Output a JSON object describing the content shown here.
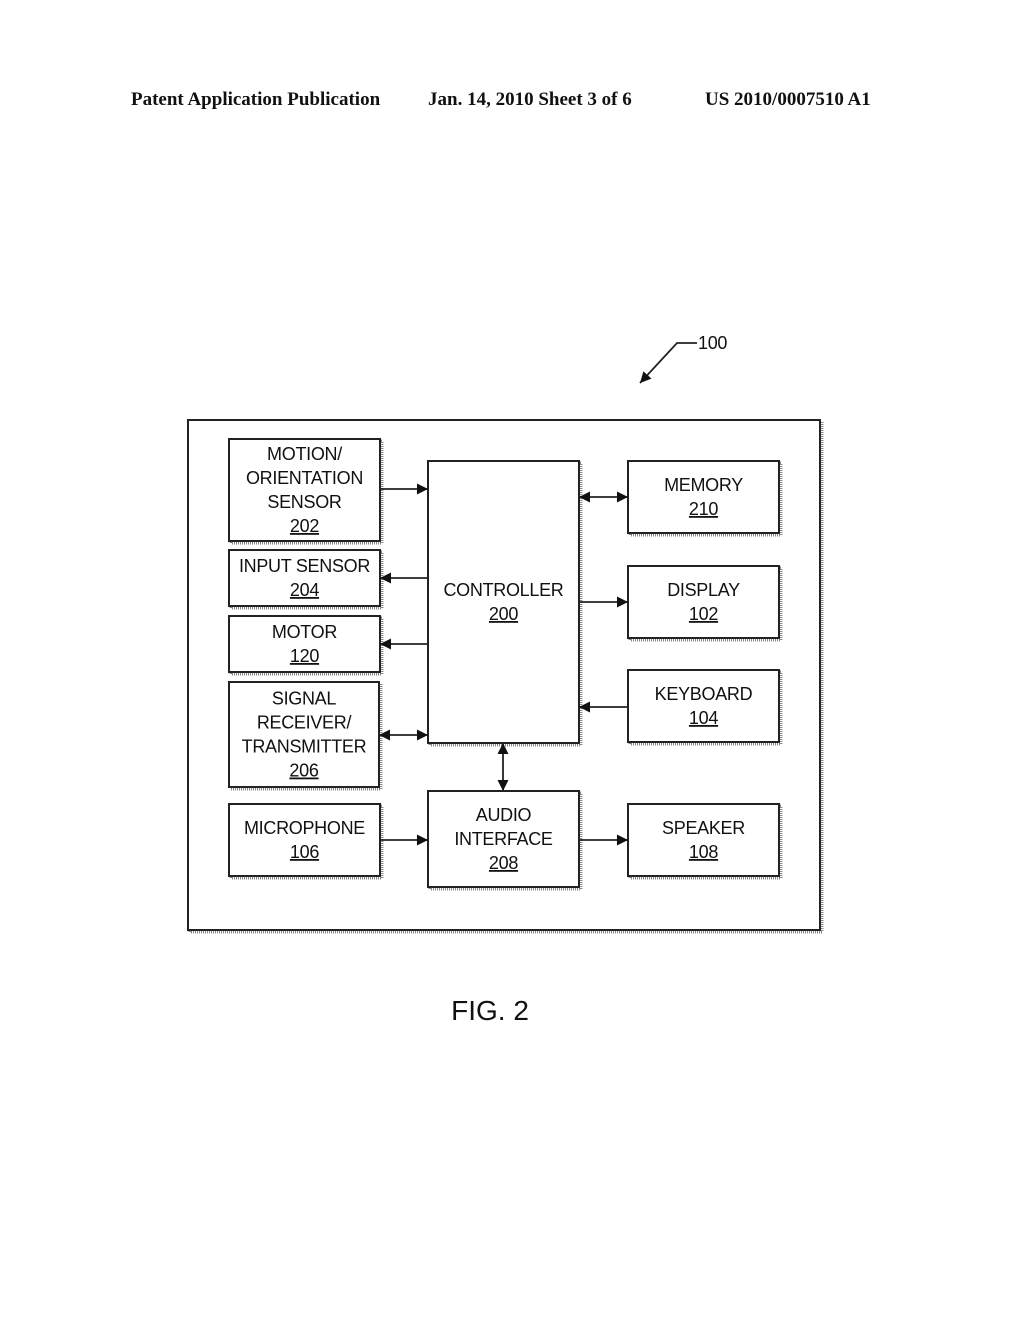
{
  "header": {
    "left": "Patent Application Publication",
    "middle": "Jan. 14, 2010  Sheet 3 of 6",
    "right": "US 2010/0007510 A1"
  },
  "diagram": {
    "reference": "100",
    "figure_label": "FIG. 2",
    "blocks": {
      "motion_sensor": {
        "lines": [
          "MOTION/",
          "ORIENTATION",
          "SENSOR"
        ],
        "number": "202"
      },
      "input_sensor": {
        "lines": [
          "INPUT SENSOR"
        ],
        "number": "204"
      },
      "motor": {
        "lines": [
          "MOTOR"
        ],
        "number": "120"
      },
      "signal": {
        "lines": [
          "SIGNAL",
          "RECEIVER/",
          "TRANSMITTER"
        ],
        "number": "206"
      },
      "microphone": {
        "lines": [
          "MICROPHONE"
        ],
        "number": "106"
      },
      "controller": {
        "lines": [
          "CONTROLLER"
        ],
        "number": "200"
      },
      "audio": {
        "lines": [
          "AUDIO",
          "INTERFACE"
        ],
        "number": "208"
      },
      "memory": {
        "lines": [
          "MEMORY"
        ],
        "number": "210"
      },
      "display": {
        "lines": [
          "DISPLAY"
        ],
        "number": "102"
      },
      "keyboard": {
        "lines": [
          "KEYBOARD"
        ],
        "number": "104"
      },
      "speaker": {
        "lines": [
          "SPEAKER"
        ],
        "number": "108"
      }
    },
    "connections": [
      {
        "from": "motion_sensor",
        "to": "controller",
        "direction": "to"
      },
      {
        "from": "controller",
        "to": "input_sensor",
        "direction": "to"
      },
      {
        "from": "controller",
        "to": "motor",
        "direction": "to"
      },
      {
        "from": "signal",
        "to": "controller",
        "direction": "both"
      },
      {
        "from": "controller",
        "to": "memory",
        "direction": "both"
      },
      {
        "from": "controller",
        "to": "display",
        "direction": "to"
      },
      {
        "from": "keyboard",
        "to": "controller",
        "direction": "to"
      },
      {
        "from": "controller",
        "to": "audio",
        "direction": "both"
      },
      {
        "from": "microphone",
        "to": "audio",
        "direction": "to"
      },
      {
        "from": "audio",
        "to": "speaker",
        "direction": "to"
      }
    ]
  }
}
